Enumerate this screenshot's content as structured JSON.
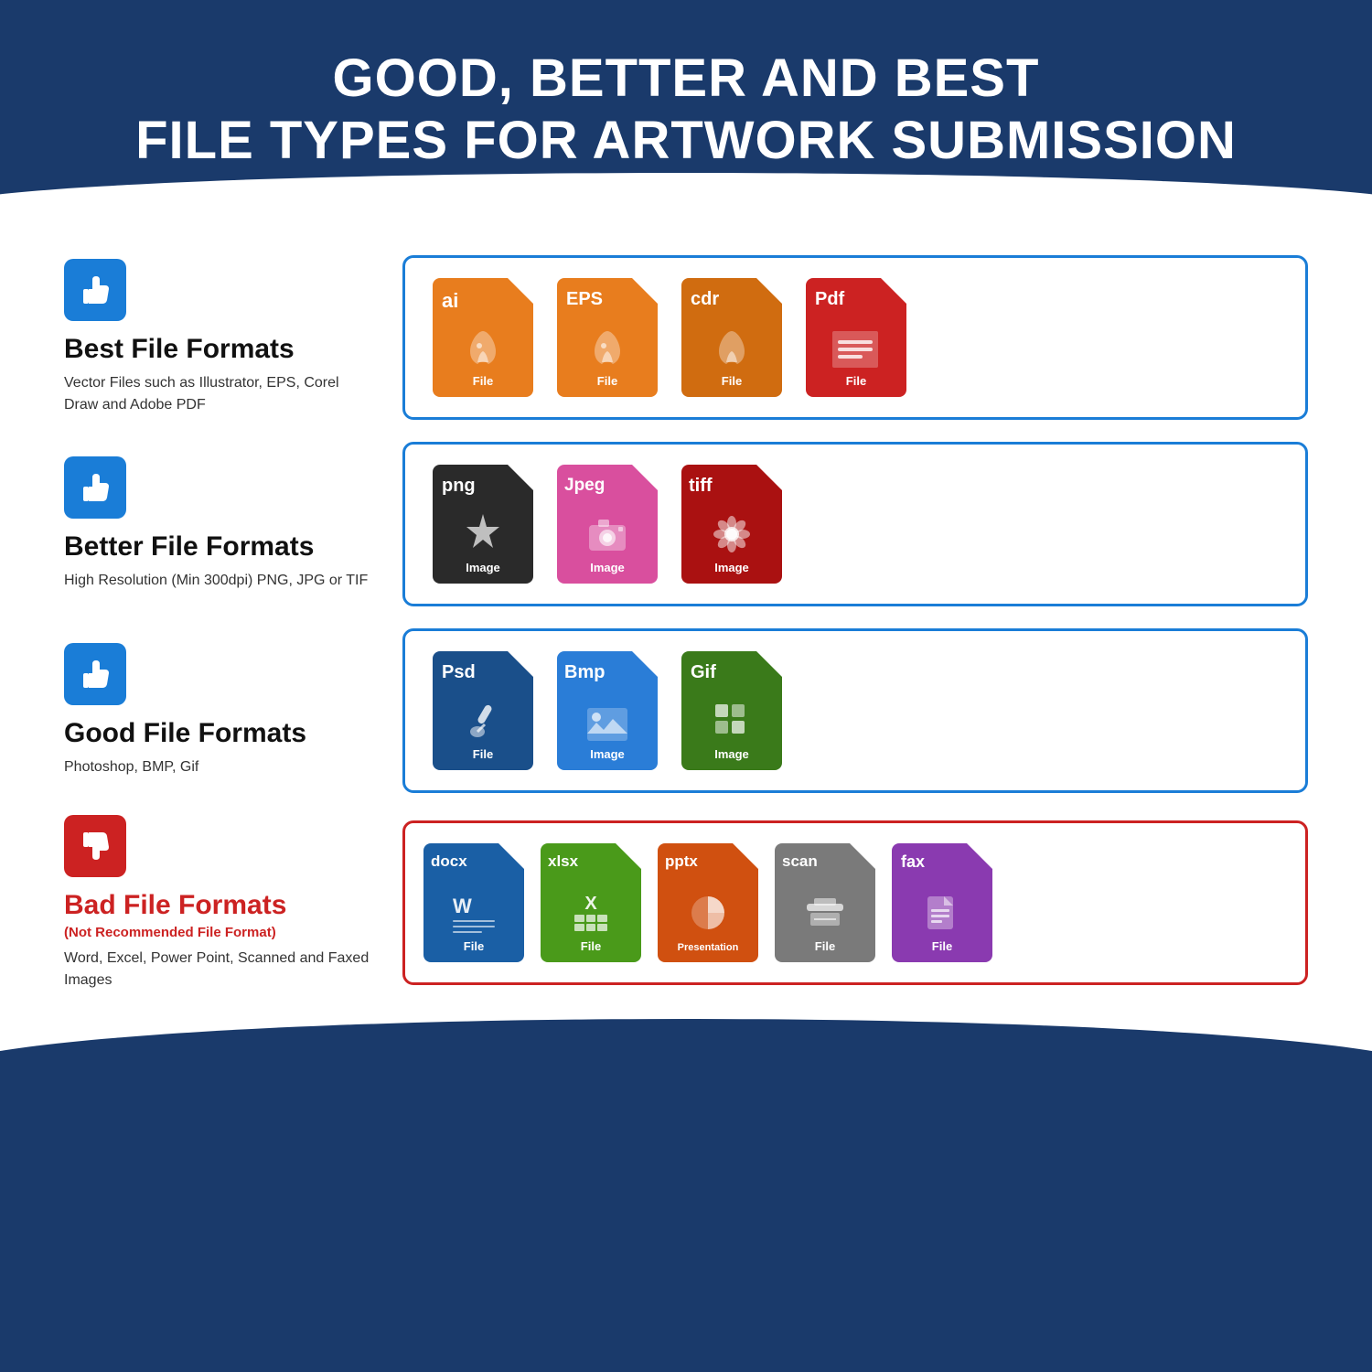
{
  "header": {
    "title_line1": "GOOD, BETTER AND BEST",
    "title_line2": "FILE TYPES FOR ARTWORK SUBMISSION"
  },
  "sections": [
    {
      "id": "best",
      "thumb": "up",
      "title": "Best File Formats",
      "subtitle": null,
      "description": "Vector Files such as Illustrator, EPS, Corel Draw and Adobe PDF",
      "border_color": "blue",
      "files": [
        {
          "ext": "ai",
          "color": "orange",
          "label": "File",
          "icon": "vector"
        },
        {
          "ext": "EPS",
          "color": "orange",
          "label": "File",
          "icon": "vector"
        },
        {
          "ext": "cdr",
          "color": "orange",
          "label": "File",
          "icon": "vector"
        },
        {
          "ext": "Pdf",
          "color": "red",
          "label": "File",
          "icon": "pdf"
        }
      ]
    },
    {
      "id": "better",
      "thumb": "up",
      "title": "Better File Formats",
      "subtitle": null,
      "description": "High Resolution (Min 300dpi) PNG, JPG or TIF",
      "border_color": "blue",
      "files": [
        {
          "ext": "png",
          "color": "dark",
          "label": "Image",
          "icon": "star"
        },
        {
          "ext": "Jpeg",
          "color": "pink",
          "label": "Image",
          "icon": "camera"
        },
        {
          "ext": "tiff",
          "color": "darkred",
          "label": "Image",
          "icon": "flower"
        }
      ]
    },
    {
      "id": "good",
      "thumb": "up",
      "title": "Good File Formats",
      "subtitle": null,
      "description": "Photoshop, BMP, Gif",
      "border_color": "blue",
      "files": [
        {
          "ext": "Psd",
          "color": "darkblue",
          "label": "File",
          "icon": "brush"
        },
        {
          "ext": "Bmp",
          "color": "midblue",
          "label": "Image",
          "icon": "landscape"
        },
        {
          "ext": "Gif",
          "color": "green",
          "label": "Image",
          "icon": "grid"
        }
      ]
    },
    {
      "id": "bad",
      "thumb": "down",
      "title": "Bad File Formats",
      "subtitle": "(Not Recommended File Format)",
      "description": "Word, Excel, Power Point, Scanned and Faxed Images",
      "border_color": "red",
      "files": [
        {
          "ext": "docx",
          "color": "docxblue",
          "label": "File",
          "icon": "word"
        },
        {
          "ext": "xlsx",
          "color": "xlsxgreen",
          "label": "File",
          "icon": "excel"
        },
        {
          "ext": "pptx",
          "color": "pptxorange",
          "label": "Presentation",
          "icon": "ppt"
        },
        {
          "ext": "scan",
          "color": "scangray",
          "label": "File",
          "icon": "scanner"
        },
        {
          "ext": "fax",
          "color": "faxpurple",
          "label": "File",
          "icon": "fax"
        }
      ]
    }
  ]
}
